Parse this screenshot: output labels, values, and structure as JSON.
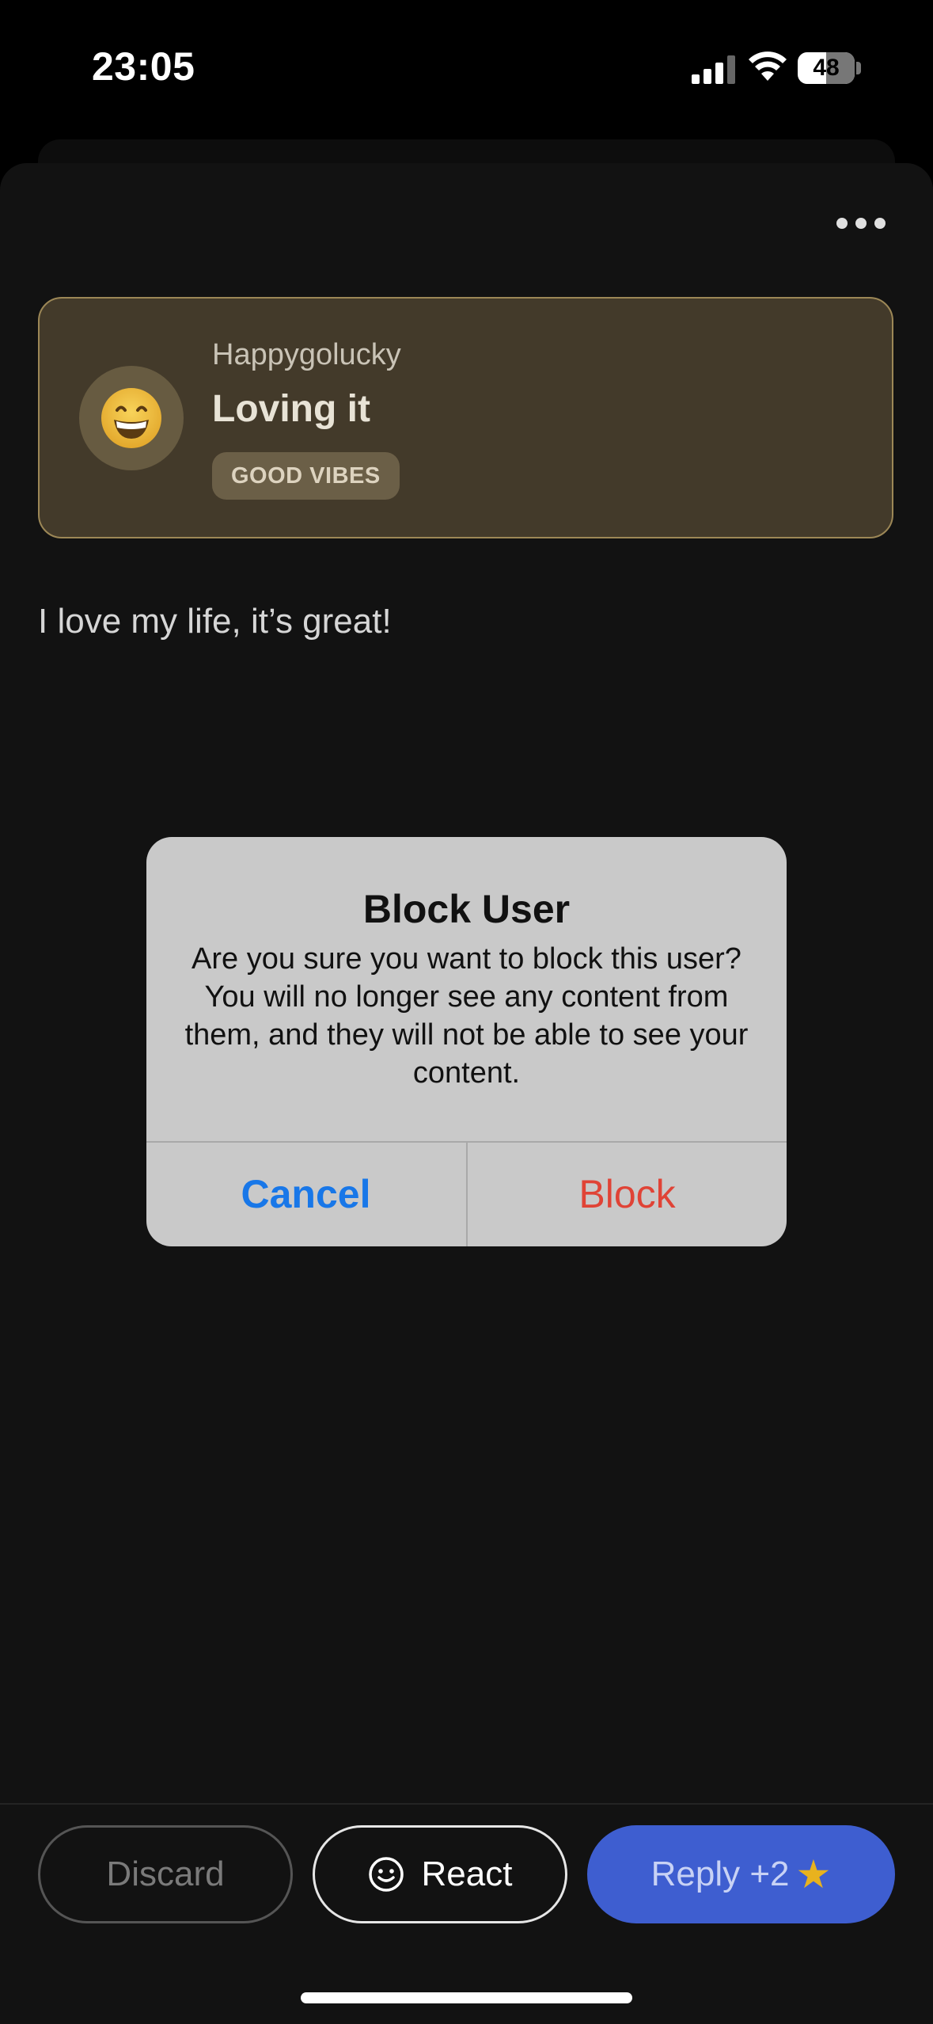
{
  "status_bar": {
    "time": "23:05",
    "battery": "48"
  },
  "post": {
    "menu_icon": "more-horizontal-icon",
    "mood": {
      "username": "Happygolucky",
      "title": "Loving it",
      "tag": "GOOD VIBES",
      "emoji_icon": "grinning-face-icon"
    },
    "text": "I love my life, it’s great!"
  },
  "dialog": {
    "title": "Block User",
    "message": "Are you sure you want to block this user? You will no longer see any content from them, and they will not be able to see your content.",
    "cancel_label": "Cancel",
    "confirm_label": "Block"
  },
  "actions": {
    "discard_label": "Discard",
    "react_label": "React",
    "reply_label": "Reply +2",
    "reply_icon": "star-icon"
  },
  "colors": {
    "accent_blue": "#3e5ed0",
    "cancel_blue": "#1877e8",
    "destructive_red": "#e04336",
    "mood_card_bg": "#433a2a"
  }
}
